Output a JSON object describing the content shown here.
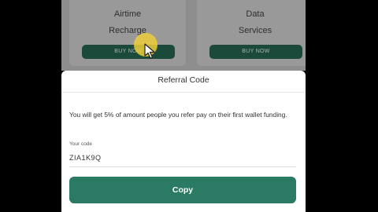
{
  "services": [
    {
      "title_line1": "Airtime",
      "title_line2": "Recharge",
      "button_label": "BUY NOW"
    },
    {
      "title_line1": "Data",
      "title_line2": "Services",
      "button_label": "BUY NOW"
    }
  ],
  "referral": {
    "title": "Referral Code",
    "description": "You will get 5% of amount people you refer pay on their first wallet funding.",
    "code_label": "Your code",
    "code_value": "ZIA1K9Q",
    "copy_label": "Copy"
  },
  "colors": {
    "buy_button": "#1c4a3a",
    "copy_button": "#2b7a64",
    "cursor_highlight": "#eccd3a"
  },
  "icons": {
    "cursor": "pointer-cursor-icon"
  }
}
